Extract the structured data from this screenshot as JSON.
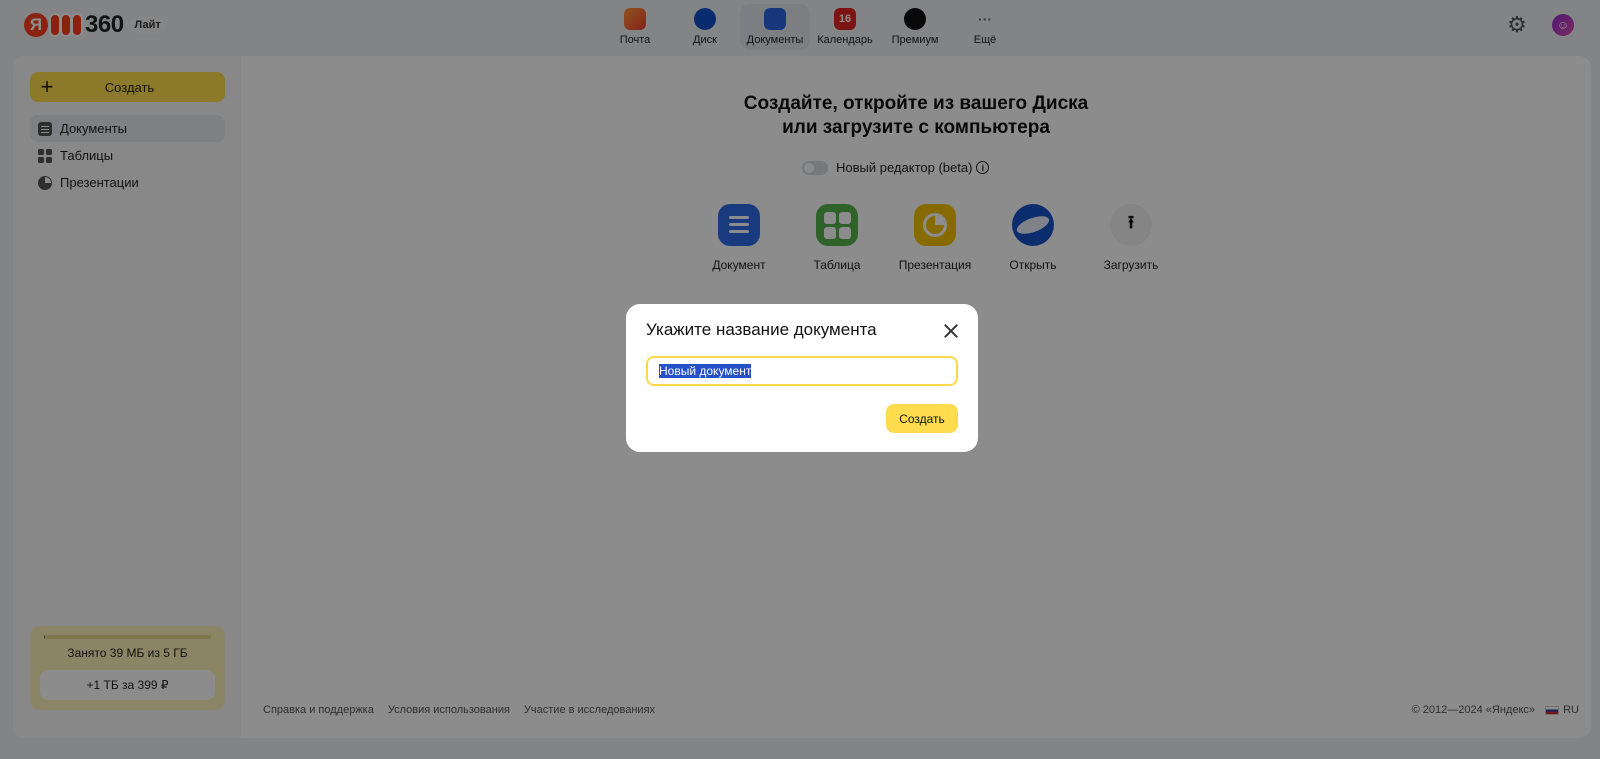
{
  "header": {
    "logo_text": "360",
    "logo_badge": "Лайт",
    "services": [
      {
        "label": "Почта",
        "icon": "mail-icon"
      },
      {
        "label": "Диск",
        "icon": "disk-icon"
      },
      {
        "label": "Документы",
        "icon": "docs-icon",
        "active": true
      },
      {
        "label": "Календарь",
        "icon": "calendar-icon",
        "badge": "16"
      },
      {
        "label": "Премиум",
        "icon": "premium-icon"
      },
      {
        "label": "Ещё",
        "icon": "more-icon",
        "glyph": "···"
      }
    ]
  },
  "sidebar": {
    "create_label": "Создать",
    "items": [
      {
        "label": "Документы",
        "active": true
      },
      {
        "label": "Таблицы"
      },
      {
        "label": "Презентации"
      }
    ],
    "storage": {
      "used_text": "Занято 39 МБ из 5 ГБ",
      "used_fraction": 0.008,
      "upsell_label": "+1 ТБ за 399 ₽"
    }
  },
  "main": {
    "headline_line1": "Создайте, откройте из вашего Диска",
    "headline_line2": "или загрузите с компьютера",
    "editor_toggle_label": "Новый редактор (beta)",
    "actions": [
      {
        "label": "Документ"
      },
      {
        "label": "Таблица"
      },
      {
        "label": "Презентация"
      },
      {
        "label": "Открыть"
      },
      {
        "label": "Загрузить"
      }
    ]
  },
  "footer": {
    "links": [
      "Справка и поддержка",
      "Условия использования",
      "Участие в исследованиях"
    ],
    "copyright": "© 2012—2024 «Яндекс»",
    "language": "RU"
  },
  "modal": {
    "title": "Укажите название документа",
    "input_value": "Новый документ",
    "submit_label": "Создать"
  },
  "colors": {
    "accent": "#ffdc4d",
    "doc": "#2e6ae6",
    "table": "#56b34a",
    "presentation": "#f7c300",
    "disk": "#1452c8"
  }
}
